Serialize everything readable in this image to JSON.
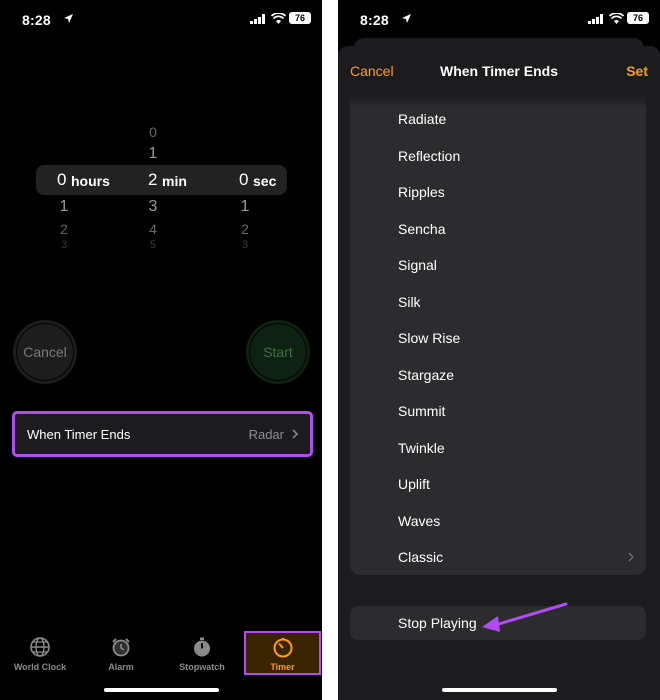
{
  "status_bar": {
    "time": "8:28",
    "battery": "76"
  },
  "picker": {
    "hours": {
      "above": [
        "",
        ""
      ],
      "selected": "0",
      "unit": "hours",
      "below": [
        "1",
        "2",
        "3"
      ]
    },
    "minutes": {
      "above": [
        "0",
        "1"
      ],
      "selected": "2",
      "unit": "min",
      "below": [
        "3",
        "4",
        "5"
      ]
    },
    "seconds": {
      "above": [
        "",
        ""
      ],
      "selected": "0",
      "unit": "sec",
      "below": [
        "1",
        "2",
        "3"
      ]
    }
  },
  "buttons": {
    "cancel": "Cancel",
    "start": "Start"
  },
  "when_timer_ends": {
    "label": "When Timer Ends",
    "value": "Radar"
  },
  "tabs": [
    {
      "label": "World Clock",
      "icon": "globe-icon"
    },
    {
      "label": "Alarm",
      "icon": "alarm-clock-icon"
    },
    {
      "label": "Stopwatch",
      "icon": "stopwatch-icon"
    },
    {
      "label": "Timer",
      "icon": "timer-icon",
      "selected": true
    }
  ],
  "sheet": {
    "cancel": "Cancel",
    "title": "When Timer Ends",
    "set": "Set",
    "sounds": [
      "Radiate",
      "Reflection",
      "Ripples",
      "Sencha",
      "Signal",
      "Silk",
      "Slow Rise",
      "Stargaze",
      "Summit",
      "Twinkle",
      "Uplift",
      "Waves",
      "Classic"
    ],
    "stop_playing": "Stop Playing"
  },
  "colors": {
    "accent": "#ff9f0a",
    "highlight": "#b14cf2",
    "background": "#000000",
    "cell": "#2c2c2e"
  }
}
